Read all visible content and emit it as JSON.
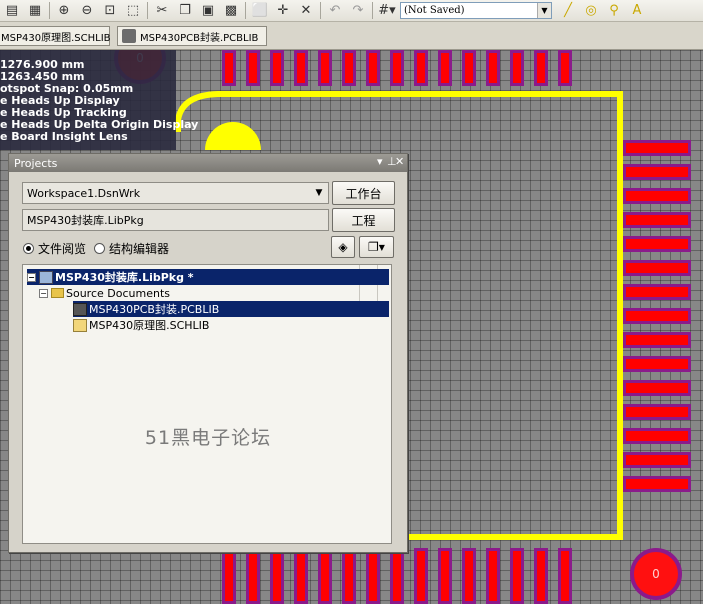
{
  "toolbar": {
    "icons": [
      "layers-icon",
      "view-icon",
      "zoom-in-icon",
      "zoom-out-icon",
      "zoom-fit-icon",
      "zoom-area-icon",
      "cut-icon",
      "copy-icon",
      "paste-icon",
      "paste-special-icon",
      "select-icon",
      "move-icon",
      "cross-icon",
      "undo-icon",
      "redo-icon",
      "grid-icon"
    ],
    "combo_value": "(Not Saved)",
    "tools": [
      "line-tool-icon",
      "arc-tool-icon",
      "pad-tool-icon",
      "string-tool-icon"
    ]
  },
  "tabs": [
    {
      "label": "MSP430原理图.SCHLIB"
    },
    {
      "label": "MSP430PCB封装.PCBLIB"
    }
  ],
  "hud": {
    "x": "1276.900 mm",
    "y": "1263.450 mm",
    "snap": "otspot Snap: 0.05mm",
    "line1": "e Heads Up Display",
    "line2": "e Heads Up Tracking",
    "line3": "e Heads Up Delta Origin Display",
    "line4": "e Board Insight Lens"
  },
  "canvas": {
    "via_label_top": "0",
    "via_label_bottom": "0",
    "colors": {
      "pad": "#ff0000",
      "pad_ring": "#8b1a8b",
      "outline": "#ffff00",
      "grid_bg": "#878787"
    }
  },
  "projects": {
    "title": "Projects",
    "workspace_value": "Workspace1.DsnWrk",
    "workspace_button": "工作台",
    "project_value": "MSP430封装库.LibPkg",
    "project_button": "工程",
    "radio_file_view": "文件阅览",
    "radio_struct_editor": "结构编辑器",
    "tree": {
      "root": "MSP430封装库.LibPkg *",
      "folder": "Source Documents",
      "doc1": "MSP430PCB封装.PCBLIB",
      "doc2": "MSP430原理图.SCHLIB"
    },
    "watermark": "51黑电子论坛"
  }
}
